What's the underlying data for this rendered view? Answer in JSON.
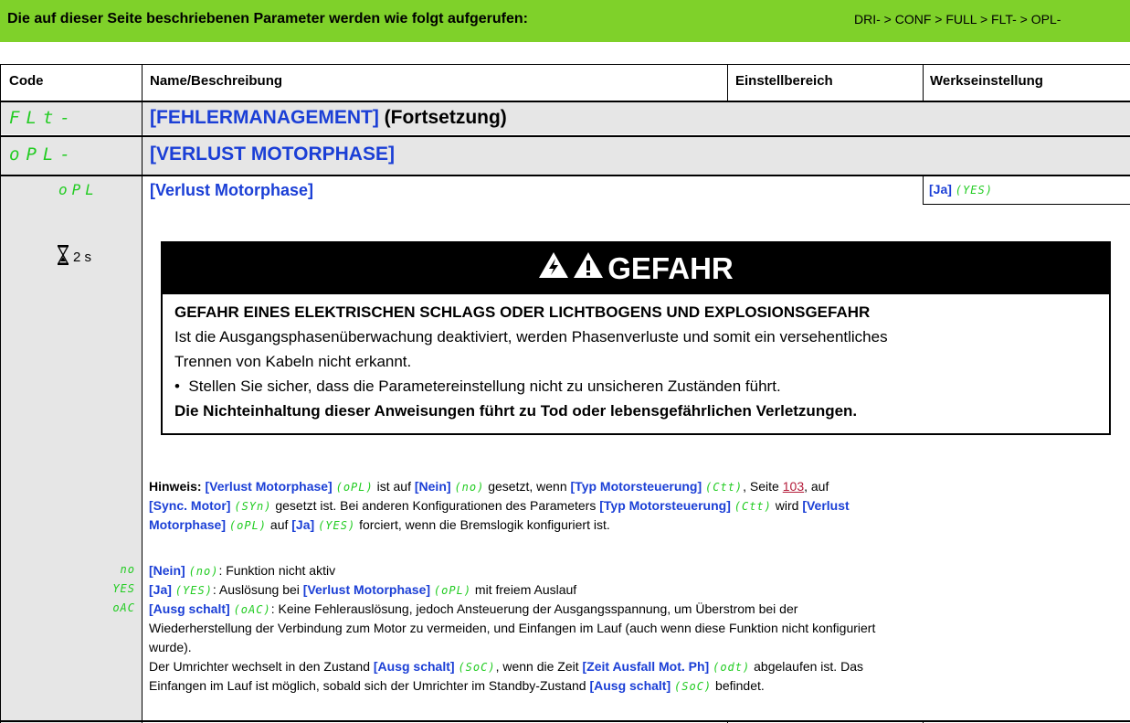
{
  "topbar": {
    "lead": "Die auf dieser Seite beschriebenen Parameter werden wie folgt aufgerufen:",
    "path": "DRI- > CONF > FULL > FLT- > OPL-"
  },
  "table": {
    "headers": {
      "code": "Code",
      "name": "Name/Beschreibung",
      "range": "Einstellbereich",
      "factory": "Werkseinstellung"
    }
  },
  "rows": {
    "flt": {
      "code": "FLt-",
      "title": "[FEHLERMANAGEMENT]",
      "suffix": " (Fortsetzung)"
    },
    "opl_menu": {
      "code": "oPL-",
      "title": "[VERLUST MOTORPHASE]"
    },
    "opl": {
      "code": "oPL",
      "title": "[Verlust Motorphase]",
      "factory_label": "[Ja]",
      "factory_code": "(YES)"
    }
  },
  "time": {
    "value": "2 s"
  },
  "danger": {
    "title": "GEFAHR",
    "subtitle": "GEFAHR EINES ELEKTRISCHEN SCHLAGS ODER LICHTBOGENS UND EXPLOSIONSGEFAHR",
    "line1": "Ist die Ausgangsphasenüberwachung deaktiviert, werden Phasenverluste und somit ein versehentliches",
    "line2": "Trennen von Kabeln nicht erkannt.",
    "bullet": "Stellen Sie sicher, dass die Parametereinstellung nicht zu unsicheren Zuständen führt.",
    "warning": "Die Nichteinhaltung dieser Anweisungen führt zu Tod oder lebensgefährlichen Verletzungen."
  },
  "note": {
    "label": "Hinweis:",
    "p1": "[Verlust Motorphase]",
    "c1": "(oPL)",
    "t1": " ist auf ",
    "p2": "[Nein]",
    "c2": "(no)",
    "t2": " gesetzt, wenn ",
    "p3": "[Typ Motorsteuerung]",
    "c3": "(Ctt)",
    "t3": ", Seite ",
    "page": "103",
    "t4": ", auf",
    "p4": "[Sync. Motor]",
    "c4": "(SYn)",
    "t5": " gesetzt ist. Bei anderen Konfigurationen des Parameters ",
    "p5": "[Typ Motorsteuerung]",
    "c5": "(Ctt)",
    "t6": " wird ",
    "p6": "[Verlust",
    "p7": "Motorphase]",
    "c7": "(oPL)",
    "t7": " auf ",
    "p8": "[Ja]",
    "c8": "(YES)",
    "t8": " forciert, wenn die Bremslogik konfiguriert ist."
  },
  "options": [
    {
      "code": "no",
      "label": "[Nein]",
      "paren": "(no)",
      "text": ": Funktion nicht aktiv"
    },
    {
      "code": "YES",
      "label": "[Ja]",
      "paren": "(YES)",
      "text": ": Auslösung bei ",
      "ref": "[Verlust Motorphase]",
      "ref_code": "(oPL)",
      "text2": " mit freiem Auslauf"
    },
    {
      "code": "oAC",
      "label": "[Ausg schalt]",
      "paren": "(oAC)",
      "text": ": Keine Fehlerauslösung, jedoch Ansteuerung der Ausgangsspannung, um Überstrom bei der"
    }
  ],
  "continuation": {
    "l1": "Wiederherstellung der Verbindung zum Motor zu vermeiden, und Einfangen im Lauf (auch wenn diese Funktion nicht konfiguriert",
    "l2": "wurde).",
    "l3a": "Der Umrichter wechselt in den Zustand ",
    "l3b": "[Ausg schalt]",
    "l3c": "(SoC)",
    "l3d": ", wenn die Zeit ",
    "l3e": "[Zeit Ausfall Mot. Ph]",
    "l3f": "(odt)",
    "l3g": " abgelaufen ist. Das",
    "l4a": "Einfangen im Lauf ist möglich, sobald sich der Umrichter im Standby-Zustand ",
    "l4b": "[Ausg schalt]",
    "l4c": "(SoC)",
    "l4d": " befindet."
  }
}
